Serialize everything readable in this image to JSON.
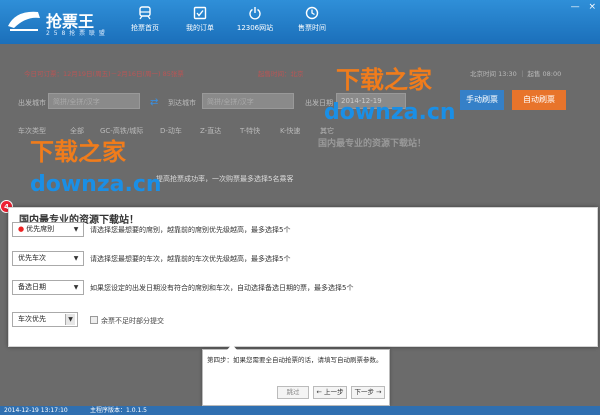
{
  "header": {
    "app_title": "抢票王",
    "app_subtitle": "2 5 8 抢 票 联 盟",
    "nav": [
      {
        "label": "抢票首页",
        "icon": "train-icon"
      },
      {
        "label": "我的订单",
        "icon": "checklist-icon"
      },
      {
        "label": "12306网站",
        "icon": "power-icon"
      },
      {
        "label": "售票时间",
        "icon": "clock-icon"
      }
    ],
    "window_buttons": {
      "minimize": "—",
      "close": "×"
    }
  },
  "dimmed": {
    "notice_left": "今日可订票：12月19日(周五)－2月16日(周一) 85张票",
    "notice_mid": "起售时间：北京",
    "notice_right": "北京时间 13:30  ｜  起售 08:00",
    "from_label": "出发城市",
    "from_placeholder": "简拼/全拼/汉字",
    "to_label": "到达城市",
    "to_placeholder": "简拼/全拼/汉字",
    "date_label": "出发日期",
    "date_value": "2014-12-19",
    "manual_button": "手动刷票",
    "auto_button": "自动刷票",
    "filter_label": "车次类型",
    "filters": [
      "全部",
      "GC-高铁/城际",
      "D-动车",
      "Z-直达",
      "T-特快",
      "K-快速",
      "其它"
    ],
    "hint_text": "提高抢票成功率，一次购票最多选择5名乘客",
    "tagline_ghost": "国内最专业的资源下载站！"
  },
  "panel": {
    "title": "国内最专业的资源下载站！",
    "step_number": "4",
    "rows": [
      {
        "select": "优先席别",
        "desc": "请选择您最想要的席别，越靠前的席别优先级越高，最多选择5个"
      },
      {
        "select": "优先车次",
        "desc": "请选择您最想要的车次，越靠前的车次优先级越高，最多选择5个"
      },
      {
        "select": "备选日期",
        "desc": "如果您设定的出发日期没有符合的席别和车次，自动选择备选日期的票，最多选择5个"
      },
      {
        "select": "车次优先",
        "desc": ""
      }
    ],
    "checkbox_label": "余票不足时部分提交"
  },
  "guide": {
    "text": "第四步：如果您需要全自动抢票的话，请填写自动刷票参数。",
    "skip": "跳过",
    "prev": "上一步",
    "next": "下一步"
  },
  "status": {
    "datetime": "2014-12-19 13:17:10",
    "version": "主程序版本：1.0.1.5"
  },
  "watermark": {
    "cn": "下载之家",
    "en": "downza.cn"
  }
}
